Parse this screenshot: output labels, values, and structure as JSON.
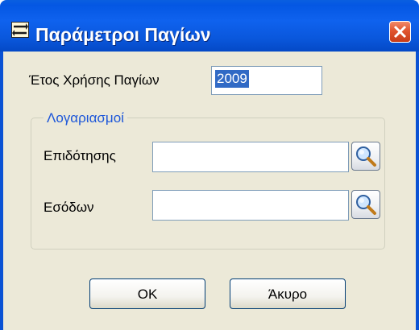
{
  "window": {
    "title": "Παράμετροι Παγίων",
    "title_icon": "transfer-arrows-icon",
    "close_icon": "close-icon"
  },
  "year": {
    "label": "Έτος Χρήσης Παγίων",
    "value": "2009"
  },
  "accounts_group": {
    "title": "Λογαριασμοί",
    "subsidy": {
      "label": "Επιδότησης",
      "value": "",
      "button_icon": "search-icon"
    },
    "income": {
      "label": "Εσόδων",
      "value": "",
      "button_icon": "search-icon"
    }
  },
  "buttons": {
    "ok_label": "OK",
    "cancel_label": "Άκυρο"
  },
  "colors": {
    "titlebar": "#0a57dc",
    "client": "#ece9d8",
    "group_title": "#1c56d9",
    "close_button": "#e0542e",
    "selection": "#316ac5"
  }
}
